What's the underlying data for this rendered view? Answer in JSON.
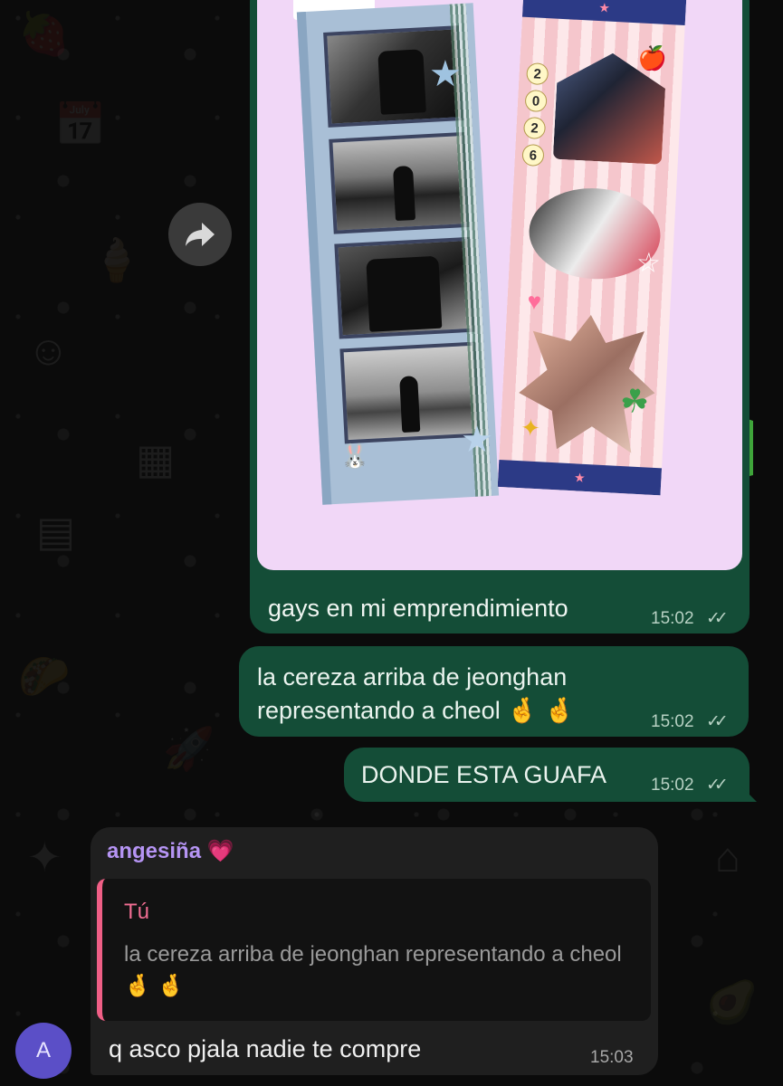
{
  "chat": {
    "forward_icon": "forward-arrow-icon",
    "outgoing": [
      {
        "caption": "gays en mi emprendimiento",
        "time": "15:02",
        "status": "read-double-check"
      },
      {
        "text": "la cereza arriba de jeonghan representando a cheol 🤞 🤞",
        "time": "15:02",
        "status": "read-double-check"
      },
      {
        "text": "DONDE ESTA GUAFA",
        "time": "15:02",
        "status": "read-double-check"
      }
    ],
    "ticks": "✓✓",
    "incoming": {
      "sender": "angesiña 💗",
      "quote": {
        "author": "Tú",
        "text": "la cereza arriba de jeonghan representando a cheol 🤞 🤞"
      },
      "text": "q asco pjala nadie te compre",
      "time": "15:03",
      "avatar_initial": "A"
    }
  },
  "photo": {
    "year_digits": [
      "2",
      "0",
      "2",
      "6"
    ],
    "band_star": "★"
  },
  "colors": {
    "outgoing_bubble": "#144d37",
    "incoming_bubble": "#1f1f1f",
    "sender_name": "#b594f3",
    "quote_author": "#f06d92",
    "avatar": "#5b4fc7"
  }
}
